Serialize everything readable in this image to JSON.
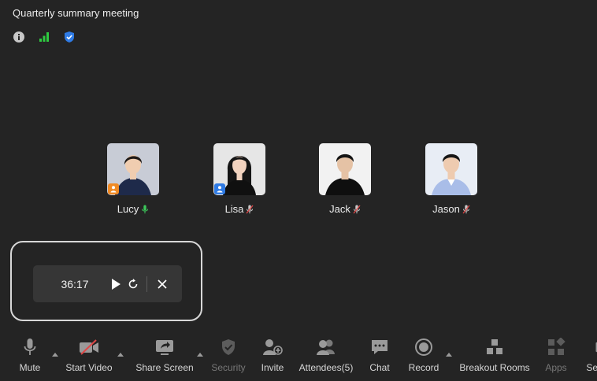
{
  "meeting": {
    "title": "Quarterly summary meeting",
    "status_icons": [
      "info-icon",
      "signal-strength-icon",
      "shield-check-icon"
    ]
  },
  "participants": [
    {
      "name": "Lucy",
      "mic": "unmuted",
      "role": "host",
      "colors": {
        "bg": "#c8ccd6",
        "hair": "#1f1a17",
        "skin": "#f0cdb0",
        "shirt": "#1e2a4a"
      }
    },
    {
      "name": "Lisa",
      "mic": "muted",
      "role": "co-host",
      "colors": {
        "bg": "#e6e6e6",
        "hair": "#151515",
        "skin": "#f2d3bf",
        "shirt": "#101010"
      }
    },
    {
      "name": "Jack",
      "mic": "muted",
      "role": "",
      "colors": {
        "bg": "#f2f2f2",
        "hair": "#141414",
        "skin": "#e5c2a5",
        "shirt": "#0f0f0f"
      }
    },
    {
      "name": "Jason",
      "mic": "muted",
      "role": "",
      "colors": {
        "bg": "#e8edf5",
        "hair": "#161616",
        "skin": "#eecbb0",
        "shirt": "#a9bde8"
      }
    }
  ],
  "timer": {
    "value": "36:17",
    "controls": [
      "play-icon",
      "restart-icon",
      "close-icon"
    ]
  },
  "toolbar": {
    "items": [
      {
        "label": "Mute",
        "icon": "microphone-icon"
      },
      {
        "label": "Start Video",
        "icon": "video-off-icon"
      },
      {
        "label": "Share Screen",
        "icon": "share-screen-icon"
      },
      {
        "label": "Security",
        "icon": "shield-icon",
        "disabled": true
      },
      {
        "label": "Invite",
        "icon": "invite-user-icon"
      },
      {
        "label": "Attendees(5)",
        "icon": "attendees-icon"
      },
      {
        "label": "Chat",
        "icon": "chat-icon"
      },
      {
        "label": "Record",
        "icon": "record-icon"
      },
      {
        "label": "Breakout Rooms",
        "icon": "breakout-rooms-icon"
      },
      {
        "label": "Apps",
        "icon": "apps-icon",
        "disabled": true
      },
      {
        "label": "Settings",
        "icon": "settings-icon"
      }
    ]
  },
  "colors": {
    "background": "#242424",
    "panel": "#363636",
    "mic_active": "#3cc85a",
    "mic_muted": "#e04848",
    "host_badge": "#f08a24",
    "cohost_badge": "#2f7be5",
    "signal": "#2ecc40",
    "shield": "#2f7be5"
  }
}
